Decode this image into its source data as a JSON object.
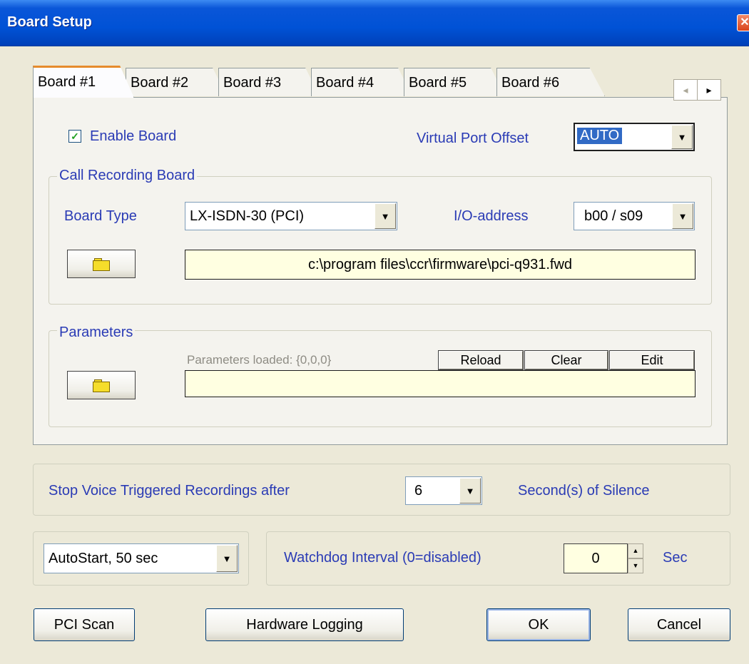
{
  "window": {
    "title": "Board Setup",
    "close_glyph": "✕"
  },
  "tabs": [
    {
      "label": "Board #1",
      "active": true
    },
    {
      "label": "Board #2"
    },
    {
      "label": "Board #3"
    },
    {
      "label": "Board #4"
    },
    {
      "label": "Board #5"
    },
    {
      "label": "Board #6"
    }
  ],
  "tab_scroll": {
    "left_glyph": "◂",
    "right_glyph": "▸"
  },
  "enable_board": {
    "label": "Enable Board",
    "checked": true,
    "check_glyph": "✓"
  },
  "virtual_port_offset": {
    "label": "Virtual Port Offset",
    "value": "AUTO"
  },
  "call_recording_board": {
    "group_label": "Call Recording Board",
    "board_type_label": "Board Type",
    "board_type_value": "LX-ISDN-30 (PCI)",
    "io_address_label": "I/O-address",
    "io_address_value": "b00 / s09",
    "firmware_path": "c:\\program files\\ccr\\firmware\\pci-q931.fwd"
  },
  "parameters": {
    "group_label": "Parameters",
    "loaded_text": "Parameters loaded: {0,0,0}",
    "reload_label": "Reload",
    "clear_label": "Clear",
    "edit_label": "Edit",
    "value": ""
  },
  "silence": {
    "prefix": "Stop Voice Triggered Recordings after",
    "value": "6",
    "suffix": "Second(s) of Silence"
  },
  "autostart": {
    "value": "AutoStart, 50 sec"
  },
  "watchdog": {
    "label": "Watchdog Interval  (0=disabled)",
    "value": "0",
    "unit": "Sec"
  },
  "buttons": {
    "pci_scan": "PCI Scan",
    "hardware_logging": "Hardware Logging",
    "ok": "OK",
    "cancel": "Cancel"
  },
  "dropdown_glyph": "▼",
  "spin_up_glyph": "▲",
  "spin_down_glyph": "▼"
}
